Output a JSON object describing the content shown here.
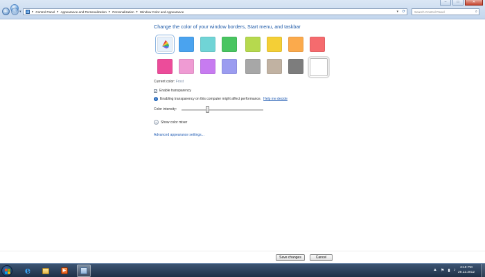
{
  "window": {
    "nav_back": "←",
    "nav_forward": "→",
    "breadcrumbs": [
      "Control Panel",
      "Appearance and Personalization",
      "Personalization",
      "Window Color and Appearance"
    ],
    "breadcrumb_separator": "▸",
    "search_placeholder": "Search Control Panel",
    "controls": {
      "minimize": "–",
      "maximize": "□",
      "close": "✕"
    }
  },
  "main": {
    "heading": "Change the color of your window borders, Start menu, and taskbar",
    "swatches_row1": [
      {
        "name": "sky",
        "color": "sky-icon",
        "selected": true
      },
      {
        "name": "twilight",
        "color": "#4aa3ef"
      },
      {
        "name": "sea",
        "color": "#70d4d6"
      },
      {
        "name": "leaf",
        "color": "#49c561"
      },
      {
        "name": "lime",
        "color": "#b6d94e"
      },
      {
        "name": "pumpkin",
        "color": "#f4cf36"
      },
      {
        "name": "tangerine",
        "color": "#fbaa4c"
      },
      {
        "name": "ruby",
        "color": "#f56b6e"
      }
    ],
    "swatches_row2": [
      {
        "name": "fuchsia",
        "color": "#ec4c9a"
      },
      {
        "name": "blush",
        "color": "#ef9bd3"
      },
      {
        "name": "violet",
        "color": "#c77bf0"
      },
      {
        "name": "lavender",
        "color": "#9b9cf0"
      },
      {
        "name": "taupe",
        "color": "#a7a7a7"
      },
      {
        "name": "chocolate",
        "color": "#c1b2a2"
      },
      {
        "name": "slate",
        "color": "#7d7d7d"
      },
      {
        "name": "frost",
        "color": "#ffffff"
      }
    ],
    "current_color_label": "Current color:",
    "current_color_value": "Frost",
    "enable_transparency_label": "Enable transparency",
    "enable_transparency_checked": true,
    "checkmark": "✓",
    "transparency_note": "Enabling transparency on this computer might affect performance.",
    "help_link": "Help me decide",
    "color_intensity_label": "Color intensity:",
    "color_intensity_value": 0.3,
    "show_color_mixer_label": "Show color mixer",
    "advanced_link": "Advanced appearance settings..."
  },
  "footer": {
    "save_label": "Save changes",
    "cancel_label": "Cancel"
  },
  "taskbar": {
    "media_label": "▶",
    "clock_time": "3:19 PM",
    "clock_date": "29.12.2012",
    "tray_icons": [
      "▲",
      "⚑",
      "▮",
      "♪"
    ]
  }
}
